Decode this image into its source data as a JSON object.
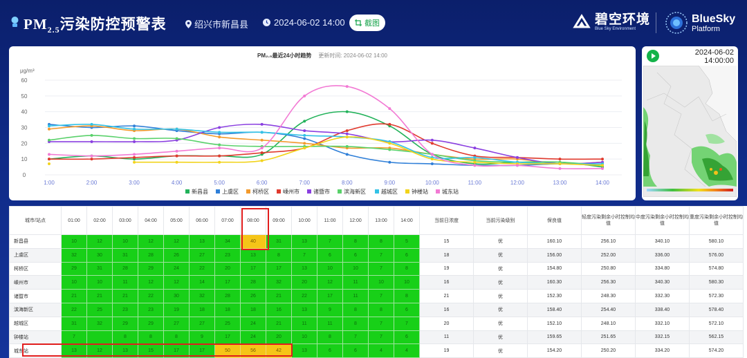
{
  "header": {
    "title_prefix": "PM",
    "title_sub": "2.5",
    "title_suffix": "污染防控预警表",
    "location": "绍兴市新昌县",
    "datetime": "2024-06-02 14:00",
    "screenshot_label": "截图",
    "brand_cn": "碧空环境",
    "brand_en": "Blue Sky Environment",
    "platform_line1": "BlueSky",
    "platform_line2": "Platform"
  },
  "chart": {
    "title": "PM₂.₅最近24小时趋势",
    "updated": "更新时间: 2024-06-02 14:00"
  },
  "chart_data": {
    "type": "line",
    "ylabel": "μg/m³",
    "ylim": [
      0,
      60
    ],
    "yticks": [
      0,
      10,
      20,
      30,
      40,
      50,
      60
    ],
    "x": [
      "1:00",
      "2:00",
      "3:00",
      "4:00",
      "5:00",
      "6:00",
      "7:00",
      "8:00",
      "9:00",
      "10:00",
      "11:00",
      "12:00",
      "13:00",
      "14:00"
    ],
    "series": [
      {
        "name": "新昌县",
        "color": "#22b25a",
        "values": [
          10,
          12,
          10,
          12,
          12,
          13,
          34,
          40,
          31,
          13,
          7,
          8,
          8,
          5
        ]
      },
      {
        "name": "上虞区",
        "color": "#2f7fd8",
        "values": [
          32,
          30,
          31,
          28,
          26,
          27,
          23,
          13,
          8,
          7,
          6,
          6,
          7,
          6
        ]
      },
      {
        "name": "柯桥区",
        "color": "#f39a2c",
        "values": [
          29,
          31,
          28,
          29,
          24,
          22,
          20,
          17,
          17,
          13,
          10,
          10,
          7,
          8
        ]
      },
      {
        "name": "嵊州市",
        "color": "#e03a2e",
        "values": [
          10,
          10,
          11,
          12,
          12,
          14,
          17,
          28,
          32,
          20,
          12,
          11,
          10,
          10
        ]
      },
      {
        "name": "诸暨市",
        "color": "#8a3fe0",
        "values": [
          21,
          21,
          21,
          22,
          30,
          32,
          28,
          26,
          21,
          22,
          17,
          11,
          7,
          8
        ]
      },
      {
        "name": "滨海新区",
        "color": "#59d16a",
        "values": [
          22,
          25,
          23,
          23,
          19,
          18,
          18,
          18,
          16,
          13,
          9,
          8,
          8,
          6
        ]
      },
      {
        "name": "越城区",
        "color": "#33c2e6",
        "values": [
          31,
          32,
          29,
          29,
          27,
          27,
          25,
          24,
          21,
          11,
          11,
          8,
          7,
          7
        ]
      },
      {
        "name": "钟楼站",
        "color": "#f2d31b",
        "values": [
          7,
          null,
          8,
          8,
          8,
          9,
          17,
          24,
          20,
          10,
          8,
          7,
          7,
          6
        ]
      },
      {
        "name": "城东站",
        "color": "#f27ad4",
        "values": [
          13,
          12,
          13,
          15,
          17,
          17,
          50,
          56,
          42,
          13,
          6,
          6,
          4,
          4
        ]
      }
    ]
  },
  "map": {
    "date": "2024-06-02",
    "time": "14:00:00"
  },
  "table": {
    "headers": [
      "城市/站点",
      "01:00",
      "02:00",
      "03:00",
      "04:00",
      "05:00",
      "06:00",
      "07:00",
      "08:00",
      "09:00",
      "10:00",
      "11:00",
      "12:00",
      "13:00",
      "14:00",
      "当前日浓度",
      "当前污染级别",
      "保良值",
      "轻度污染剩余小时控制均值",
      "中度污染剩余小时控制均值",
      "重度污染剩余小时控制均值"
    ],
    "rows": [
      {
        "name": "新昌县",
        "vals": [
          "10",
          "12",
          "10",
          "12",
          "12",
          "13",
          "34",
          "40",
          "31",
          "13",
          "7",
          "8",
          "8",
          "5"
        ],
        "conc": "15",
        "level": "优",
        "good": "160.10",
        "light": "256.10",
        "mid": "340.10",
        "heavy": "580.10"
      },
      {
        "name": "上虞区",
        "vals": [
          "32",
          "30",
          "31",
          "28",
          "26",
          "27",
          "23",
          "13",
          "8",
          "7",
          "6",
          "6",
          "7",
          "6"
        ],
        "conc": "18",
        "level": "优",
        "good": "156.00",
        "light": "252.00",
        "mid": "336.00",
        "heavy": "576.00"
      },
      {
        "name": "柯桥区",
        "vals": [
          "29",
          "31",
          "28",
          "29",
          "24",
          "22",
          "20",
          "17",
          "17",
          "13",
          "10",
          "10",
          "7",
          "8"
        ],
        "conc": "19",
        "level": "优",
        "good": "154.80",
        "light": "250.80",
        "mid": "334.80",
        "heavy": "574.80"
      },
      {
        "name": "嵊州市",
        "vals": [
          "10",
          "10",
          "11",
          "12",
          "12",
          "14",
          "17",
          "28",
          "32",
          "20",
          "12",
          "11",
          "10",
          "10"
        ],
        "conc": "16",
        "level": "优",
        "good": "160.30",
        "light": "256.30",
        "mid": "340.30",
        "heavy": "580.30"
      },
      {
        "name": "诸暨市",
        "vals": [
          "21",
          "21",
          "21",
          "22",
          "30",
          "32",
          "28",
          "26",
          "21",
          "22",
          "17",
          "11",
          "7",
          "8"
        ],
        "conc": "21",
        "level": "优",
        "good": "152.30",
        "light": "248.30",
        "mid": "332.30",
        "heavy": "572.30"
      },
      {
        "name": "滨海新区",
        "vals": [
          "22",
          "25",
          "23",
          "23",
          "19",
          "18",
          "18",
          "18",
          "16",
          "13",
          "9",
          "8",
          "8",
          "6"
        ],
        "conc": "16",
        "level": "优",
        "good": "158.40",
        "light": "254.40",
        "mid": "338.40",
        "heavy": "578.40"
      },
      {
        "name": "越城区",
        "vals": [
          "31",
          "32",
          "29",
          "29",
          "27",
          "27",
          "25",
          "24",
          "21",
          "11",
          "11",
          "8",
          "7",
          "7"
        ],
        "conc": "20",
        "level": "优",
        "good": "152.10",
        "light": "248.10",
        "mid": "332.10",
        "heavy": "572.10"
      },
      {
        "name": "钟楼站",
        "vals": [
          "7",
          "",
          "8",
          "8",
          "8",
          "9",
          "17",
          "24",
          "20",
          "10",
          "8",
          "7",
          "7",
          "6"
        ],
        "conc": "11",
        "level": "优",
        "good": "159.65",
        "light": "251.65",
        "mid": "332.15",
        "heavy": "562.15"
      },
      {
        "name": "城东站",
        "vals": [
          "13",
          "12",
          "13",
          "15",
          "17",
          "17",
          "50",
          "56",
          "42",
          "13",
          "6",
          "6",
          "4",
          "4"
        ],
        "conc": "19",
        "level": "优",
        "good": "154.20",
        "light": "250.20",
        "mid": "334.20",
        "heavy": "574.20"
      }
    ],
    "yellow_threshold": 35
  }
}
